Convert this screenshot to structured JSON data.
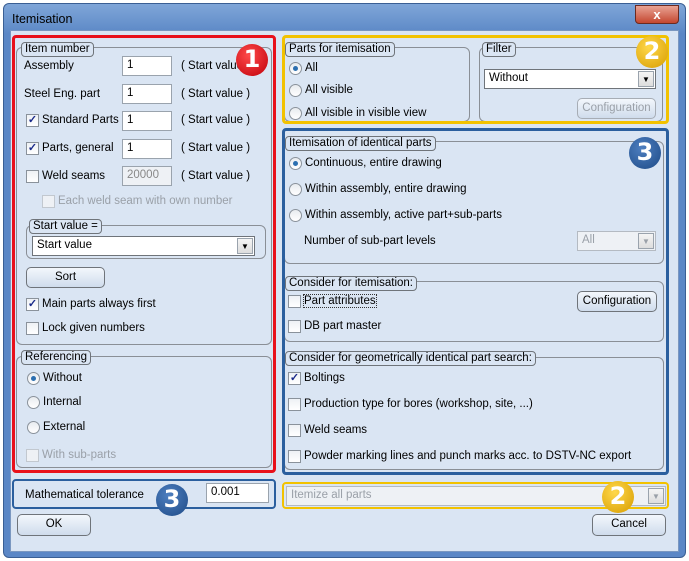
{
  "window": {
    "title": "Itemisation",
    "close": "x"
  },
  "colors": {
    "red": "#e8101a",
    "yellow": "#f2c200",
    "blue": "#2b5f9e"
  },
  "badges": {
    "one": "1",
    "two": "2",
    "three": "3"
  },
  "item_number": {
    "legend": "Item number",
    "rows": [
      {
        "label": "Assembly",
        "value": "1",
        "suffix": "( Start value )"
      },
      {
        "label": "Steel Eng. part",
        "value": "1",
        "suffix": "( Start value )"
      },
      {
        "label": "Standard Parts",
        "value": "1",
        "suffix": "( Start value )",
        "checked": true
      },
      {
        "label": "Parts, general",
        "value": "1",
        "suffix": "( Start value )",
        "checked": true
      },
      {
        "label": "Weld seams",
        "value": "20000",
        "suffix": "( Start value )",
        "checked": false
      }
    ],
    "each_weld": "Each weld seam with own number",
    "start_value_legend": "Start value =",
    "start_value_select": "Start value",
    "sort": "Sort",
    "main_parts_first": "Main parts always first",
    "lock_numbers": "Lock given numbers"
  },
  "referencing": {
    "legend": "Referencing",
    "options": [
      "Without",
      "Internal",
      "External"
    ],
    "selected": "Without",
    "with_sub_parts": "With sub-parts"
  },
  "tolerance": {
    "label": "Mathematical tolerance",
    "value": "0.001"
  },
  "parts_for_itemisation": {
    "legend": "Parts for itemisation",
    "options": [
      "All",
      "All visible",
      "All visible in visible view"
    ],
    "selected": "All"
  },
  "filter": {
    "legend": "Filter",
    "value": "Without",
    "configuration": "Configuration"
  },
  "identical": {
    "legend": "Itemisation of identical parts",
    "options": [
      "Continuous, entire drawing",
      "Within assembly, entire drawing",
      "Within assembly,  active part+sub-parts"
    ],
    "selected": "Continuous, entire drawing",
    "sub_levels_label": "Number of sub-part levels",
    "sub_levels_value": "All"
  },
  "consider": {
    "legend": "Consider for itemisation:",
    "part_attributes": "Part attributes",
    "db_part_master": "DB part master",
    "configuration": "Configuration"
  },
  "geom": {
    "legend": "Consider for geometrically identical part search:",
    "items": [
      "Boltings",
      "Production type for bores (workshop, site, ...)",
      "Weld seams",
      "Powder marking lines and punch marks acc. to DSTV-NC export"
    ]
  },
  "itemize_select": "Itemize all parts",
  "ok": "OK",
  "cancel": "Cancel"
}
